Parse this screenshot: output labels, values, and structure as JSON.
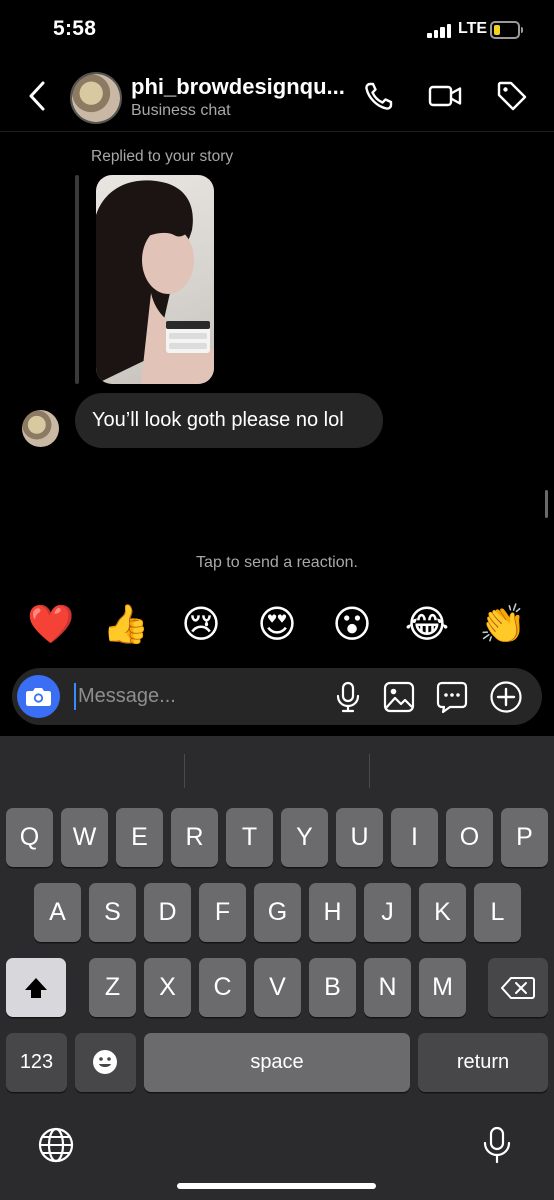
{
  "status_bar": {
    "time": "5:58",
    "network": "LTE",
    "battery_level": 0.2,
    "signal_bars": 4
  },
  "header": {
    "name": "phi_browdesignqu...",
    "subtitle": "Business chat",
    "icons": [
      "back-chevron-icon",
      "phone-icon",
      "video-camera-icon",
      "tag-icon"
    ]
  },
  "messages": {
    "replied_label": "Replied to your story",
    "bubble_text": "You’ll look goth please no lol"
  },
  "reactions": {
    "hint": "Tap to send a reaction.",
    "items": [
      {
        "emoji": "❤️",
        "name": "heart"
      },
      {
        "emoji": "👍",
        "name": "thumbs-up"
      },
      {
        "emoji": "😢",
        "name": "crying-face"
      },
      {
        "emoji": "😍",
        "name": "heart-eyes"
      },
      {
        "emoji": "😮",
        "name": "surprised-face"
      },
      {
        "emoji": "😂",
        "name": "tears-of-joy"
      },
      {
        "emoji": "👏",
        "name": "clapping-hands"
      }
    ]
  },
  "composer": {
    "placeholder": "Message...",
    "icons": [
      "camera-icon",
      "microphone-icon",
      "gallery-icon",
      "sticker-icon",
      "plus-icon"
    ]
  },
  "keyboard": {
    "row1": [
      "Q",
      "W",
      "E",
      "R",
      "T",
      "Y",
      "U",
      "I",
      "O",
      "P"
    ],
    "row2": [
      "A",
      "S",
      "D",
      "F",
      "G",
      "H",
      "J",
      "K",
      "L"
    ],
    "row3": [
      "Z",
      "X",
      "C",
      "V",
      "B",
      "N",
      "M"
    ],
    "numbers_label": "123",
    "space_label": "space",
    "return_label": "return"
  },
  "colors": {
    "background": "#000000",
    "bubble": "#262626",
    "accent": "#3a6ef5",
    "secondary_text": "#a8a8a8"
  }
}
